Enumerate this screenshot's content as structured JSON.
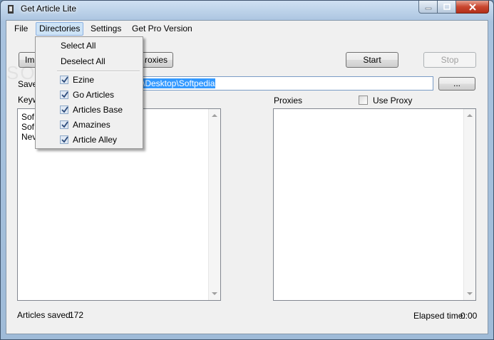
{
  "window": {
    "title": "Get Article Lite"
  },
  "menu": {
    "items": [
      {
        "label": "File"
      },
      {
        "label": "Directories"
      },
      {
        "label": "Settings"
      },
      {
        "label": "Get Pro Version"
      }
    ]
  },
  "dropdown": {
    "select_all": "Select All",
    "deselect_all": "Deselect All",
    "directories": [
      {
        "label": "Ezine",
        "checked": true
      },
      {
        "label": "Go Articles",
        "checked": true
      },
      {
        "label": "Articles Base",
        "checked": true
      },
      {
        "label": "Amazines",
        "checked": true
      },
      {
        "label": "Article Alley",
        "checked": true
      }
    ]
  },
  "toolbar": {
    "import_label": "Imp",
    "proxies_label": "roxies",
    "start_label": "Start",
    "stop_label": "Stop"
  },
  "save": {
    "label": "Save",
    "path": "\\Desktop\\Softpedia",
    "browse_label": "..."
  },
  "keywords": {
    "label": "Keyw",
    "items": [
      "Sof",
      "Sof",
      "Nev"
    ]
  },
  "proxies": {
    "label": "Proxies",
    "use_proxy_label": "Use Proxy"
  },
  "status": {
    "articles_saved_label": "Articles saved",
    "articles_saved_count": "172",
    "elapsed_label": "Elapsed time:",
    "elapsed_value": "0:00"
  }
}
